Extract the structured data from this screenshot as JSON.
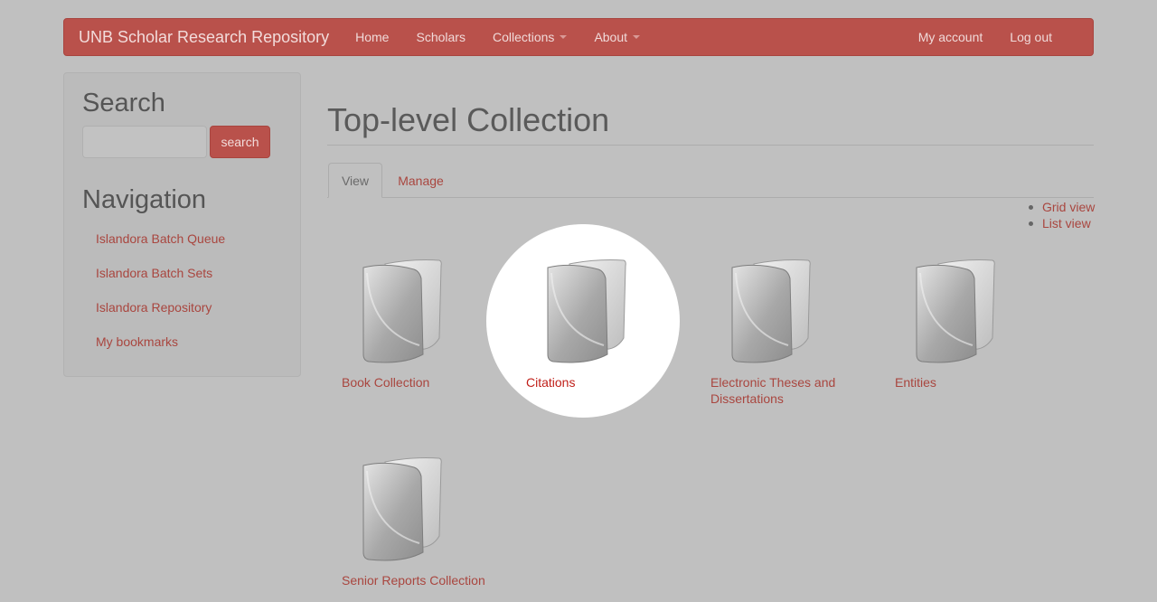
{
  "navbar": {
    "brand": "UNB Scholar Research Repository",
    "links": [
      "Home",
      "Scholars",
      "Collections",
      "About"
    ],
    "right_links": [
      "My account",
      "Log out"
    ]
  },
  "sidebar": {
    "search_heading": "Search",
    "search_button": "search",
    "nav_heading": "Navigation",
    "nav_items": [
      "Islandora Batch Queue",
      "Islandora Batch Sets",
      "Islandora Repository",
      "My bookmarks"
    ]
  },
  "main": {
    "title": "Top-level Collection",
    "tabs": [
      "View",
      "Manage"
    ],
    "view_links": [
      "Grid view",
      "List view"
    ],
    "collections": [
      {
        "label": "Book Collection"
      },
      {
        "label": "Citations"
      },
      {
        "label": "Electronic Theses and Dissertations"
      },
      {
        "label": "Entities"
      },
      {
        "label": "Senior Reports Collection"
      }
    ]
  },
  "icons": {
    "folder": "folder-icon"
  },
  "colors": {
    "brand": "#b9514b",
    "link": "#a9463f",
    "background": "#c0c0c0"
  }
}
